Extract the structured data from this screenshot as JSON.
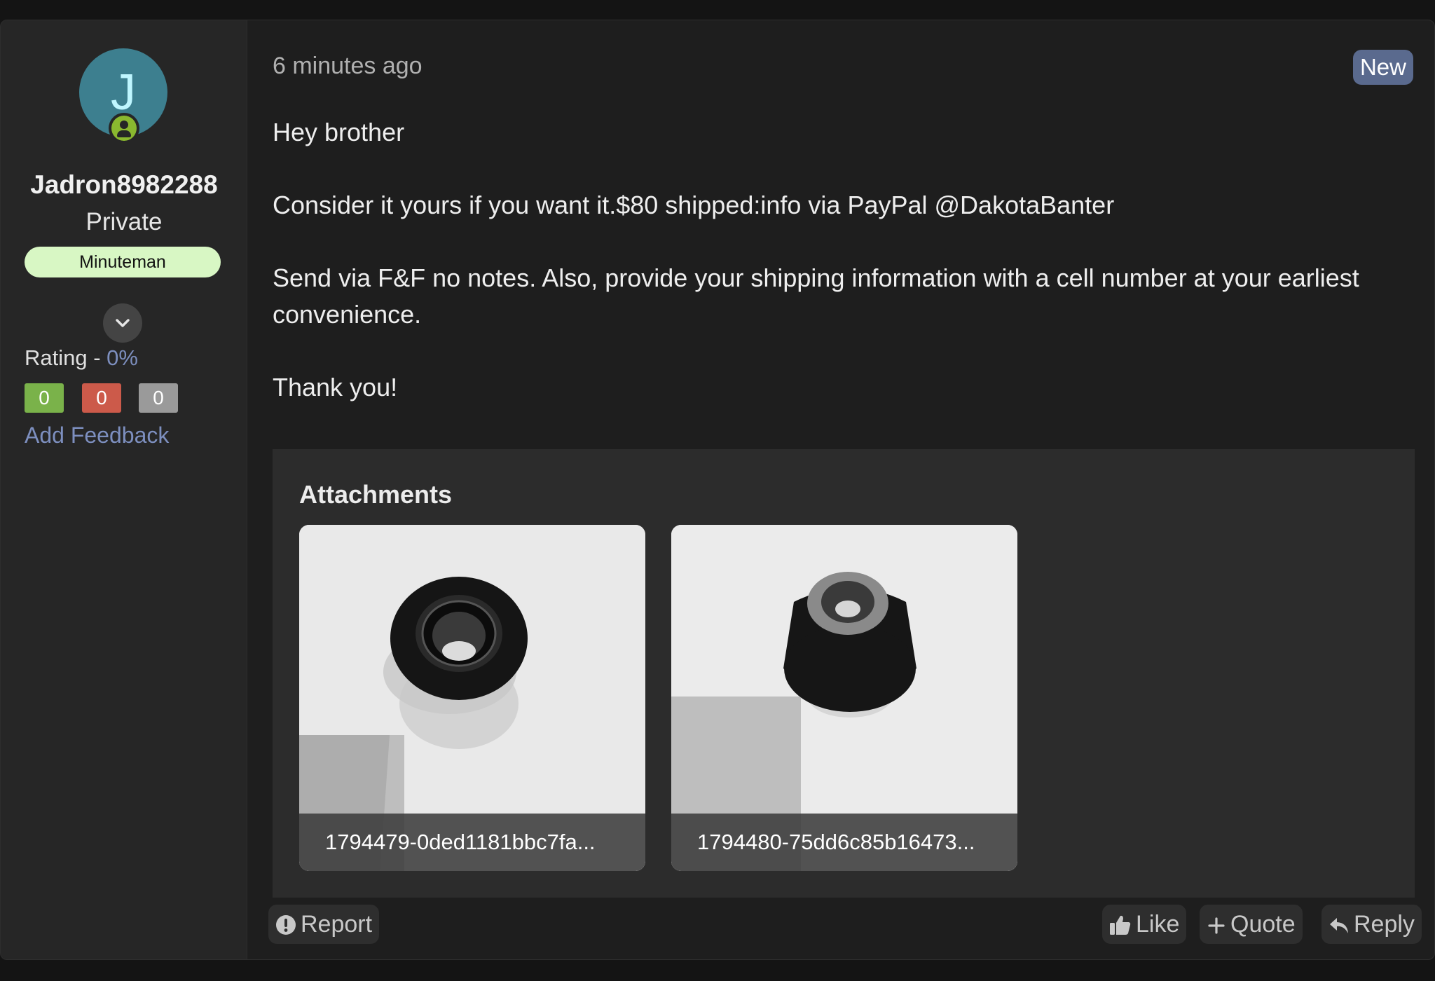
{
  "user": {
    "avatar_letter": "J",
    "username": "Jadron8982288",
    "title": "Private",
    "banner": "Minuteman",
    "rating_label": "Rating - ",
    "rating_value": "0%",
    "feedback": {
      "positive": "0",
      "negative": "0",
      "neutral": "0"
    },
    "add_feedback": "Add Feedback"
  },
  "post": {
    "timestamp": "6 minutes ago",
    "badge": "New",
    "paragraphs": [
      "Hey brother",
      "Consider it yours if you want it.$80 shipped:info via PayPal @DakotaBanter",
      "Send via F&F no notes. Also, provide your shipping information with a cell number at your earliest convenience.",
      "Thank you!"
    ],
    "attachments_title": "Attachments",
    "attachments": [
      {
        "filename": "1794479-0ded1181bbc7fa..."
      },
      {
        "filename": "1794480-75dd6c85b16473..."
      }
    ]
  },
  "actions": {
    "report": "Report",
    "like": "Like",
    "quote": "Quote",
    "reply": "Reply"
  },
  "colors": {
    "accent_link": "#7d8fbf",
    "banner_bg": "#d8f7c4",
    "positive": "#7ab24a",
    "negative": "#cc5a4a",
    "neutral": "#9a9a9a",
    "new_badge": "#5a6a8e"
  }
}
